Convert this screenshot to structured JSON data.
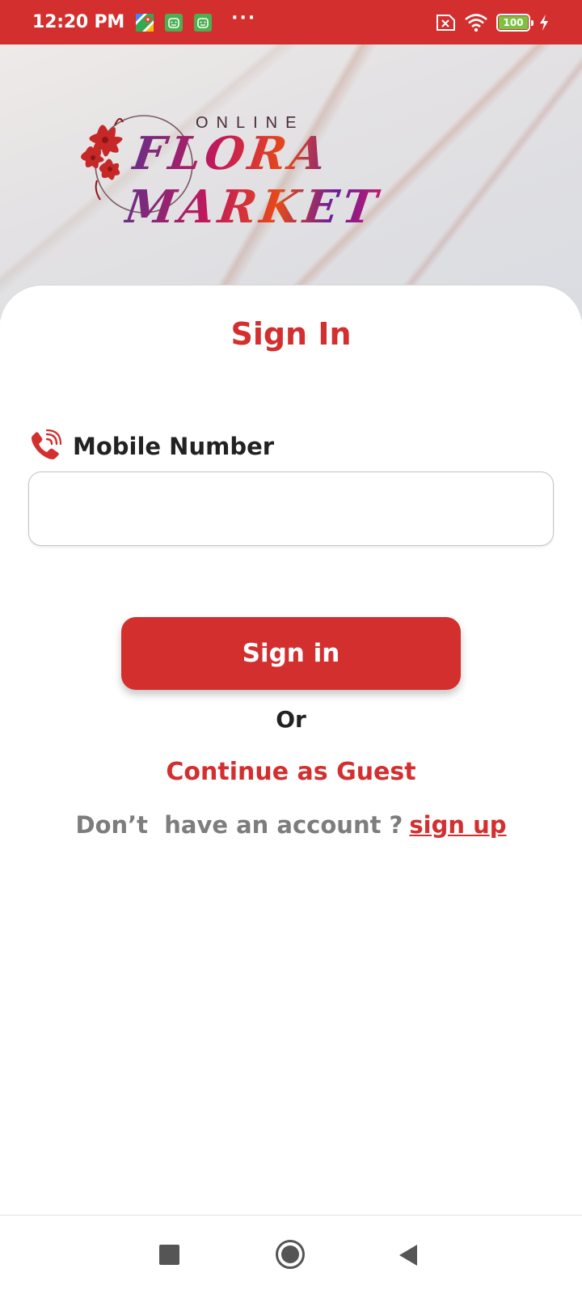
{
  "status_bar": {
    "time": "12:20 PM",
    "battery_level": "100",
    "notification_icons": [
      "maps-icon",
      "android-icon",
      "android-icon"
    ],
    "system_icons": [
      "no-sim-icon",
      "wifi-icon",
      "battery-icon",
      "charging-icon"
    ]
  },
  "header": {
    "logo_top": "ONLINE",
    "logo_main": "FLORA MARKET"
  },
  "signin": {
    "title": "Sign In",
    "mobile_label": "Mobile Number",
    "mobile_value": "",
    "mobile_placeholder": "",
    "button_label": "Sign in",
    "or_text": "Or",
    "guest_label": "Continue as Guest",
    "signup_prompt": "Don’t  have an account ?",
    "signup_link": "sign up"
  },
  "nav_bar": {
    "buttons": [
      "recent-apps",
      "home",
      "back"
    ]
  },
  "colors": {
    "accent": "#d32f2f",
    "status_bar": "#d32f2f",
    "muted_text": "#7d7d7d",
    "battery": "#7cc242"
  }
}
